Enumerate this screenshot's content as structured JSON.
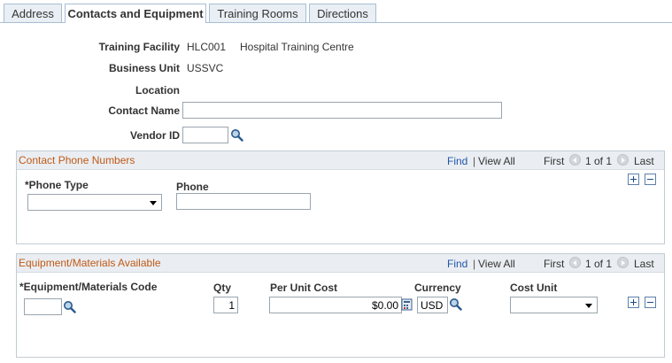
{
  "tabs": [
    {
      "label": "Address"
    },
    {
      "label": "Contacts and Equipment"
    },
    {
      "label": "Training Rooms"
    },
    {
      "label": "Directions"
    }
  ],
  "header": {
    "training_facility_label": "Training Facility",
    "training_facility_code": "HLC001",
    "training_facility_name": "Hospital Training Centre",
    "business_unit_label": "Business Unit",
    "business_unit_value": "USSVC",
    "location_label": "Location",
    "contact_name_label": "Contact Name",
    "contact_name_value": "",
    "vendor_id_label": "Vendor ID",
    "vendor_id_value": ""
  },
  "phone_section": {
    "title": "Contact Phone Numbers",
    "find": "Find",
    "separator": "|",
    "view_all": "View All",
    "first": "First",
    "page_info": "1 of 1",
    "last": "Last",
    "phone_type_header": "*Phone Type",
    "phone_header": "Phone",
    "phone_type_value": "",
    "phone_value": ""
  },
  "equipment_section": {
    "title": "Equipment/Materials Available",
    "find": "Find",
    "separator": "|",
    "view_all": "View All",
    "first": "First",
    "page_info": "1 of 1",
    "last": "Last",
    "code_header": "*Equipment/Materials Code",
    "qty_header": "Qty",
    "cost_header": "Per Unit Cost",
    "currency_header": "Currency",
    "cost_unit_header": "Cost Unit",
    "code_value": "",
    "qty_value": "1",
    "cost_value": "$0.00",
    "currency_value": "USD",
    "cost_unit_value": ""
  }
}
